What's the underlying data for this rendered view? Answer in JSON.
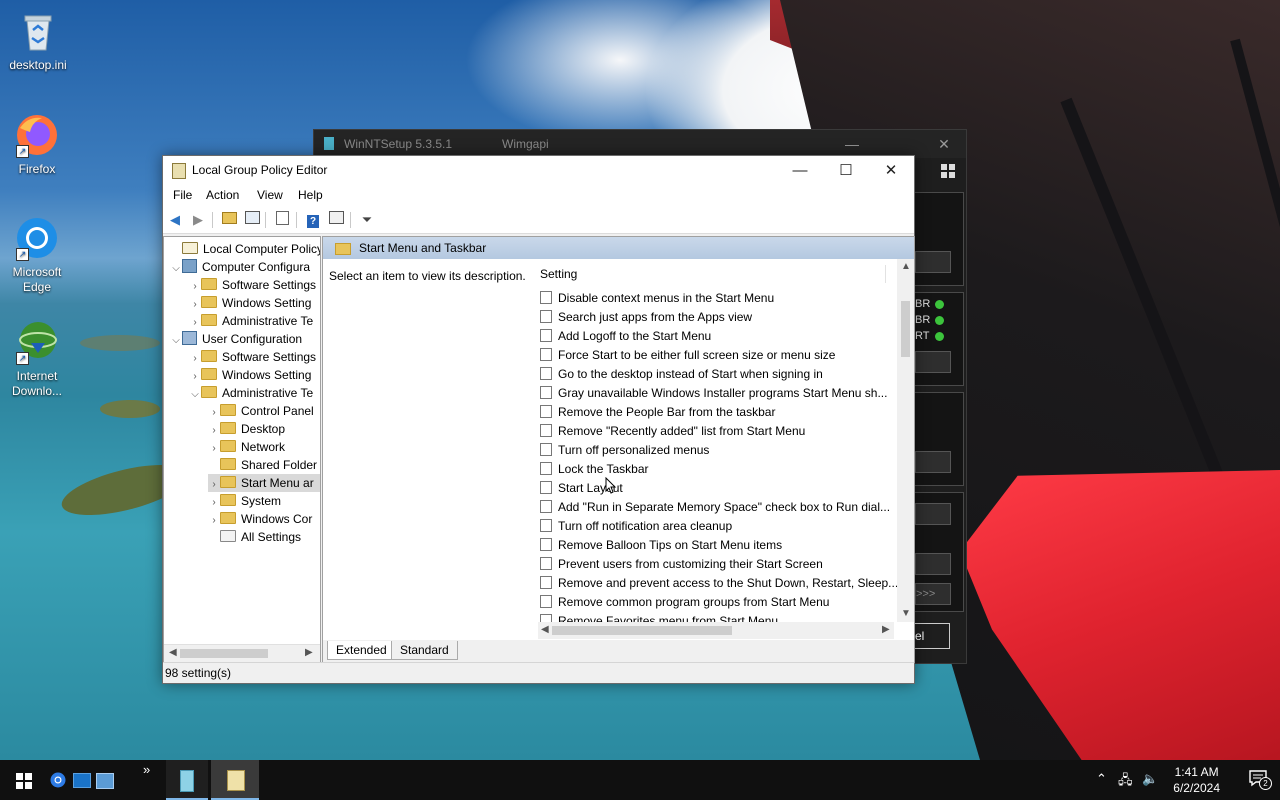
{
  "desktop": {
    "icons": [
      {
        "label": "desktop.ini",
        "icon": "recycle-bin-icon"
      },
      {
        "label": "Firefox",
        "icon": "firefox-icon"
      },
      {
        "label": "Microsoft Edge",
        "icon": "edge-icon"
      },
      {
        "label": "Internet Downlo...",
        "icon": "internet-download-manager-icon"
      }
    ]
  },
  "background_window": {
    "title": "WinNTSetup 5.3.5.1",
    "subtitle": "Wimgapi",
    "labels": [
      "BR",
      "BR",
      "RT"
    ],
    "button_fragment": ">>>",
    "button_fragment2": "el"
  },
  "gpe": {
    "title": "Local Group Policy Editor",
    "menu": [
      "File",
      "Action",
      "View",
      "Help"
    ],
    "tree": [
      {
        "label": "Local Computer Policy",
        "level": 0,
        "icon": "policy"
      },
      {
        "label": "Computer Configura",
        "level": 0,
        "icon": "computer",
        "expanded": true
      },
      {
        "label": "Software Settings",
        "level": 1,
        "icon": "folder"
      },
      {
        "label": "Windows Setting",
        "level": 1,
        "icon": "folder"
      },
      {
        "label": "Administrative Te",
        "level": 1,
        "icon": "folder"
      },
      {
        "label": "User Configuration",
        "level": 0,
        "icon": "user",
        "expanded": true
      },
      {
        "label": "Software Settings",
        "level": 1,
        "icon": "folder"
      },
      {
        "label": "Windows Setting",
        "level": 1,
        "icon": "folder"
      },
      {
        "label": "Administrative Te",
        "level": 1,
        "icon": "folder",
        "expanded": true
      },
      {
        "label": "Control Panel",
        "level": 2,
        "icon": "folder"
      },
      {
        "label": "Desktop",
        "level": 2,
        "icon": "folder"
      },
      {
        "label": "Network",
        "level": 2,
        "icon": "folder"
      },
      {
        "label": "Shared Folder",
        "level": 2,
        "icon": "folder"
      },
      {
        "label": "Start Menu ar",
        "level": 2,
        "icon": "folder",
        "selected": true
      },
      {
        "label": "System",
        "level": 2,
        "icon": "folder"
      },
      {
        "label": "Windows Cor",
        "level": 2,
        "icon": "folder"
      },
      {
        "label": "All Settings",
        "level": 2,
        "icon": "all-settings"
      }
    ],
    "pane_title": "Start Menu and Taskbar",
    "description": "Select an item to view its description.",
    "column_header": "Setting",
    "settings": [
      "Disable context menus in the Start Menu",
      "Search just apps from the Apps view",
      "Add Logoff to the Start Menu",
      "Force Start to be either full screen size or menu size",
      "Go to the desktop instead of Start when signing in",
      "Gray unavailable Windows Installer programs Start Menu sh...",
      "Remove the People Bar from the taskbar",
      "Remove \"Recently added\" list from Start Menu",
      "Turn off personalized menus",
      "Lock the Taskbar",
      "Start Layout",
      "Add \"Run in Separate Memory Space\" check box to Run dial...",
      "Turn off notification area cleanup",
      "Remove Balloon Tips on Start Menu items",
      "Prevent users from customizing their Start Screen",
      "Remove and prevent access to the Shut Down, Restart, Sleep...",
      "Remove common program groups from Start Menu",
      "Remove Favorites menu from Start Menu"
    ],
    "tabs": [
      "Extended",
      "Standard"
    ],
    "status": "98 setting(s)"
  },
  "taskbar": {
    "time": "1:41 AM",
    "date": "6/2/2024",
    "notification_count": "2",
    "overflow": "»"
  }
}
